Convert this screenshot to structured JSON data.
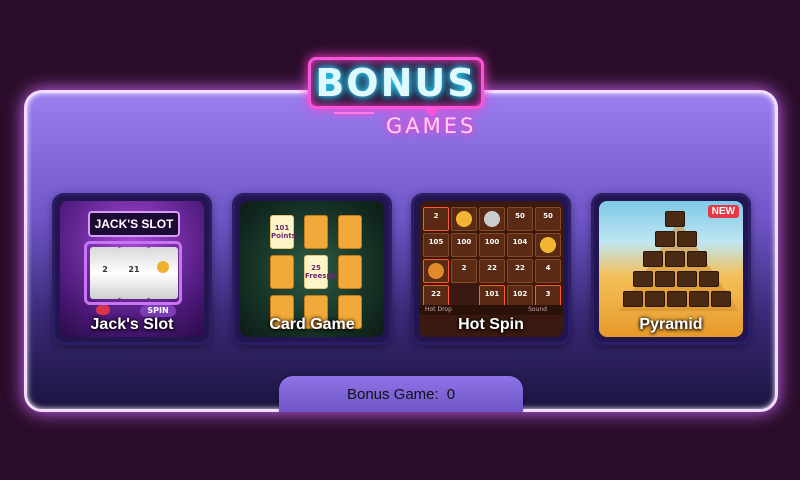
{
  "logo": {
    "top": "BONUS",
    "bottom": "GAMES"
  },
  "games": [
    {
      "label": "Jack's Slot",
      "art_title": "JACK'S SLOT",
      "reels": [
        "2",
        "21",
        ""
      ],
      "spin_label": "SPIN"
    },
    {
      "label": "Card Game",
      "face_cards": [
        {
          "value": "101",
          "unit": "Points"
        },
        {
          "value": "25",
          "unit": "Freespins"
        }
      ]
    },
    {
      "label": "Hot Spin",
      "cells": [
        "2",
        "",
        "",
        "50",
        "50",
        "105",
        "100",
        "100",
        "104",
        "",
        "",
        "2",
        "22",
        "22",
        "4",
        "22",
        "101",
        "102",
        "3"
      ],
      "bar_left": "Hot Drop",
      "bar_right": "Sound"
    },
    {
      "label": "Pyramid",
      "badge": "NEW"
    }
  ],
  "bonus_counter": {
    "label": "Bonus Game:",
    "value": "0"
  }
}
